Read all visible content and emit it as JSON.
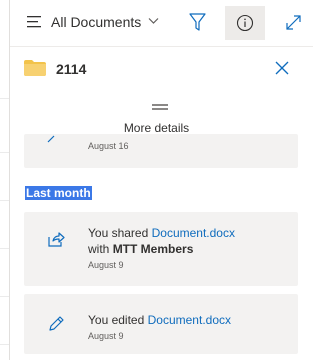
{
  "toolbar": {
    "view_name": "All Documents",
    "icons": [
      "hamburger-icon",
      "chevron-down-icon",
      "filter-icon",
      "info-icon",
      "expand-icon"
    ]
  },
  "panel": {
    "title": "2114",
    "folder_color": "#f2c34b",
    "more_details_label": "More details",
    "accent": "#0f6cbd"
  },
  "activity": {
    "previous_item": {
      "date": "August 16"
    },
    "section_label": "Last month",
    "items": [
      {
        "icon": "share-icon",
        "prefix": "You shared ",
        "document": "Document.docx",
        "line2_prefix": "with ",
        "line2_target": "MTT Members",
        "date": "August 9"
      },
      {
        "icon": "pencil-icon",
        "prefix": "You edited ",
        "document": "Document.docx",
        "date": "August 9"
      }
    ]
  }
}
